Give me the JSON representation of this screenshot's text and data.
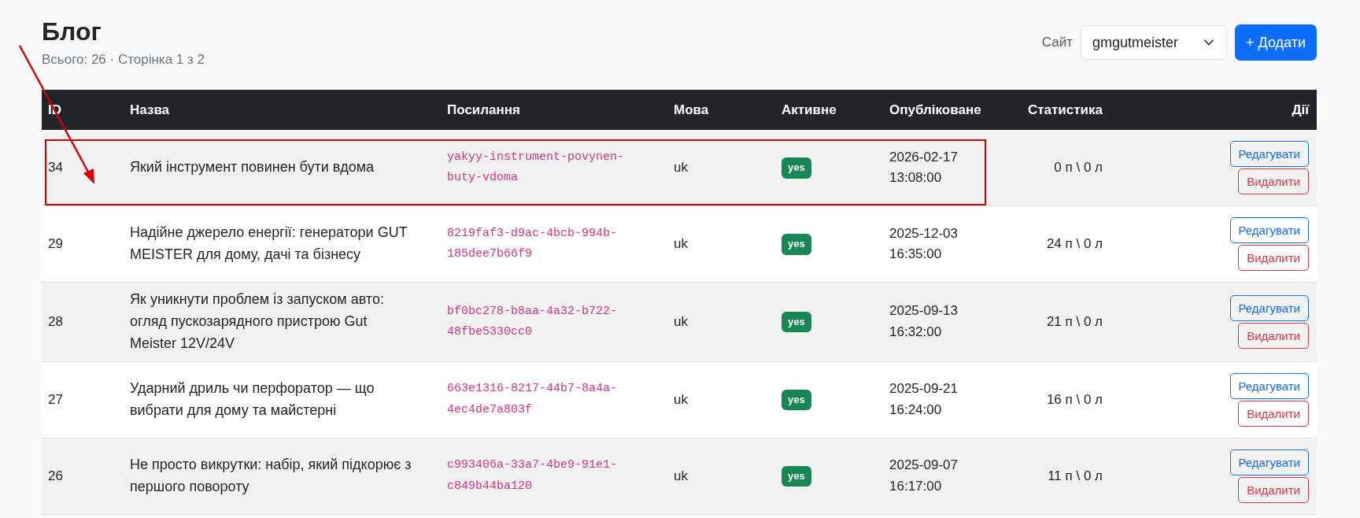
{
  "page": {
    "title": "Блог",
    "subtitle": "Всього: 26 · Сторінка 1 з 2"
  },
  "site_filter": {
    "label": "Сайт",
    "value": "gmgutmeister"
  },
  "add_button": "+ Додати",
  "table": {
    "columns": [
      "ID",
      "Назва",
      "Посилання",
      "Мова",
      "Активне",
      "Опубліковане",
      "Статистика",
      "Дії"
    ],
    "rows": [
      {
        "id": "34",
        "title": "Який інструмент повинен бути вдома",
        "slug": "yakyy-instrument-povynen-buty-vdoma",
        "language": "uk",
        "active": "yes",
        "published": [
          "2026-02-17",
          "13:08:00"
        ],
        "stats": "0 п \\ 0 л",
        "edit": "Редагувати",
        "delete": "Видалити",
        "highlighted": true
      },
      {
        "id": "29",
        "title": "Надійне джерело енергії: генератори GUT MEISTER для дому, дачі та бізнесу",
        "slug": "8219faf3-d9ac-4bcb-994b-185dee7b66f9",
        "language": "uk",
        "active": "yes",
        "published": [
          "2025-12-03",
          "16:35:00"
        ],
        "stats": "24 п \\ 0 л",
        "edit": "Редагувати",
        "delete": "Видалити",
        "highlighted": false
      },
      {
        "id": "28",
        "title": "Як уникнути проблем із запуском авто: огляд пускозарядного пристрою Gut Meister 12V/24V",
        "slug": "bf0bc278-b8aa-4a32-b722-48fbe5330cc0",
        "language": "uk",
        "active": "yes",
        "published": [
          "2025-09-13",
          "16:32:00"
        ],
        "stats": "21 п \\ 0 л",
        "edit": "Редагувати",
        "delete": "Видалити",
        "highlighted": false
      },
      {
        "id": "27",
        "title": "Ударний дриль чи перфоратор — що вибрати для дому та майстерні",
        "slug": "663e1316-8217-44b7-8a4a-4ec4de7a803f",
        "language": "uk",
        "active": "yes",
        "published": [
          "2025-09-21",
          "16:24:00"
        ],
        "stats": "16 п \\ 0 л",
        "edit": "Редагувати",
        "delete": "Видалити",
        "highlighted": false
      },
      {
        "id": "26",
        "title": "Не просто викрутки: набір, який підкорює з першого повороту",
        "slug": "c993406a-33a7-4be9-91e1-c849b44ba120",
        "language": "uk",
        "active": "yes",
        "published": [
          "2025-09-07",
          "16:17:00"
        ],
        "stats": "11 п \\ 0 л",
        "edit": "Редагувати",
        "delete": "Видалити",
        "highlighted": false
      }
    ]
  }
}
